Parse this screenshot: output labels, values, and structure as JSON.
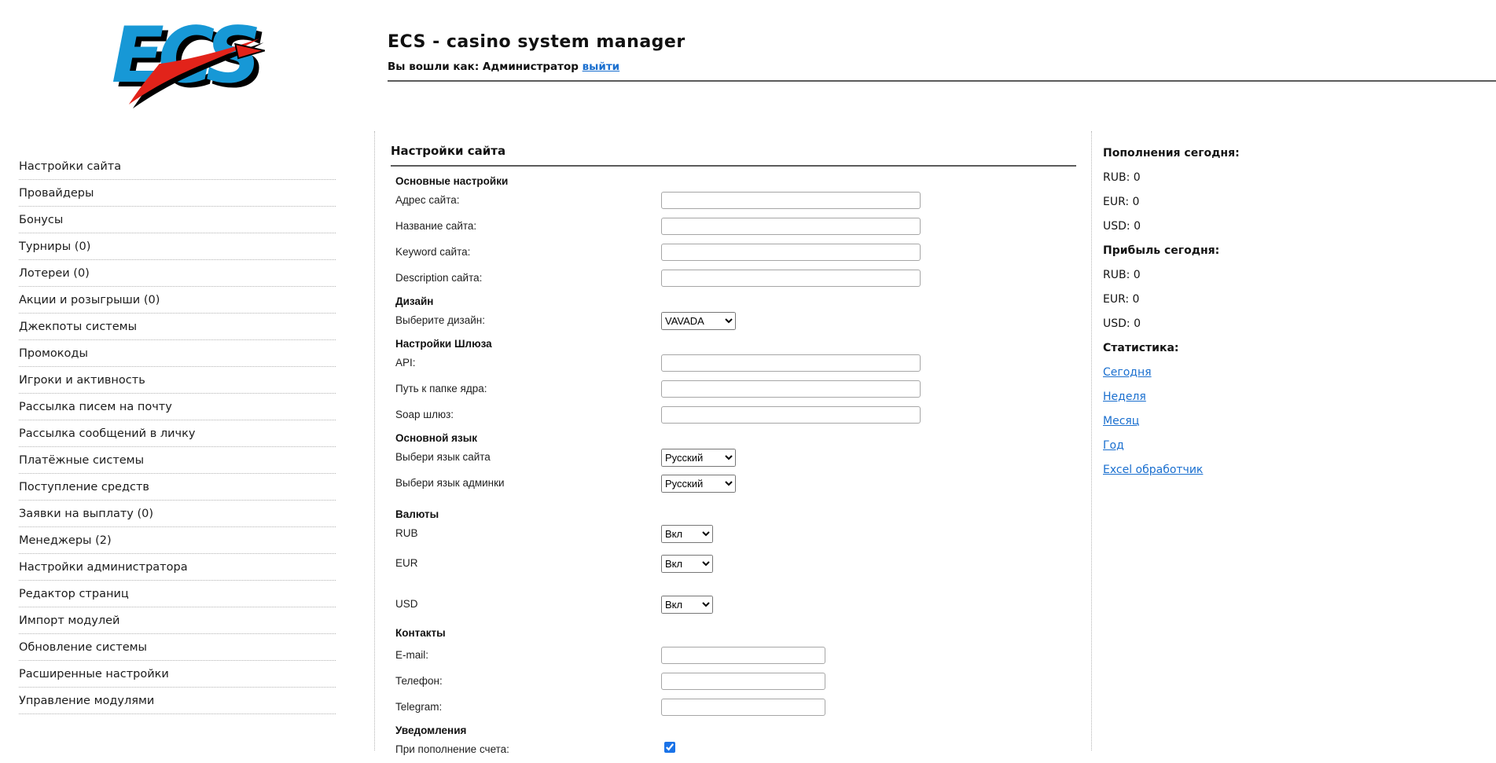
{
  "header": {
    "logo_text": "ECS",
    "title": "ECS - casino system manager",
    "login_prefix": "Вы вошли как: Администратор",
    "logout_label": "выйти"
  },
  "colors": {
    "link_blue": "#1a6fcf",
    "checkbox_accent": "#1a73e8",
    "logo_blue": "#1798d6",
    "logo_red": "#e2231a",
    "rule_gray": "#5b5b5b",
    "dotted_gray": "#b3b3b3"
  },
  "sidebar": {
    "items": [
      "Настройки сайта",
      "Провайдеры",
      "Бонусы",
      "Турниры (0)",
      "Лотереи (0)",
      "Акции и розыгрыши (0)",
      "Джекпоты системы",
      "Промокоды",
      "Игроки и активность",
      "Рассылка писем на почту",
      "Рассылка сообщений в личку",
      "Платёжные системы",
      "Поступление средств",
      "Заявки на выплату (0)",
      "Менеджеры (2)",
      "Настройки администратора",
      "Редактор страниц",
      "Импорт модулей",
      "Обновление системы",
      "Расширенные настройки",
      "Управление модулями"
    ]
  },
  "main": {
    "title": "Настройки сайта",
    "headings": {
      "basic": "Основные настройки",
      "design": "Дизайн",
      "gateway": "Настройки Шлюза",
      "language": "Основной язык",
      "currencies": "Валюты",
      "contacts": "Контакты",
      "notifications": "Уведомления"
    },
    "labels": {
      "site_address": "Адрес сайта:",
      "site_name": "Название сайта:",
      "site_keyword": "Keyword сайта:",
      "site_description": "Description сайта:",
      "choose_design": "Выберите дизайн:",
      "api": "API:",
      "core_path": "Путь к папке ядра:",
      "soap": "Soap шлюз:",
      "site_lang": "Выбери язык сайта",
      "admin_lang": "Выбери язык админки",
      "rub": "RUB",
      "eur": "EUR",
      "usd": "USD",
      "email": "E-mail:",
      "phone": "Телефон:",
      "telegram": "Telegram:",
      "on_deposit": "При пополнение счета:"
    },
    "selects": {
      "design": "VAVADA",
      "site_lang": "Русский",
      "admin_lang": "Русский",
      "rub": "Вкл",
      "eur": "Вкл",
      "usd": "Вкл"
    },
    "on_deposit_checked": true
  },
  "aside": {
    "deposits_title": "Пополнения сегодня:",
    "deposits": [
      "RUB: 0",
      "EUR: 0",
      "USD: 0"
    ],
    "profit_title": "Прибыль сегодня:",
    "profit": [
      "RUB: 0",
      "EUR: 0",
      "USD: 0"
    ],
    "stats_title": "Статистика:",
    "links": [
      "Сегодня",
      "Неделя",
      "Месяц",
      "Год",
      "Excel обработчик"
    ]
  }
}
